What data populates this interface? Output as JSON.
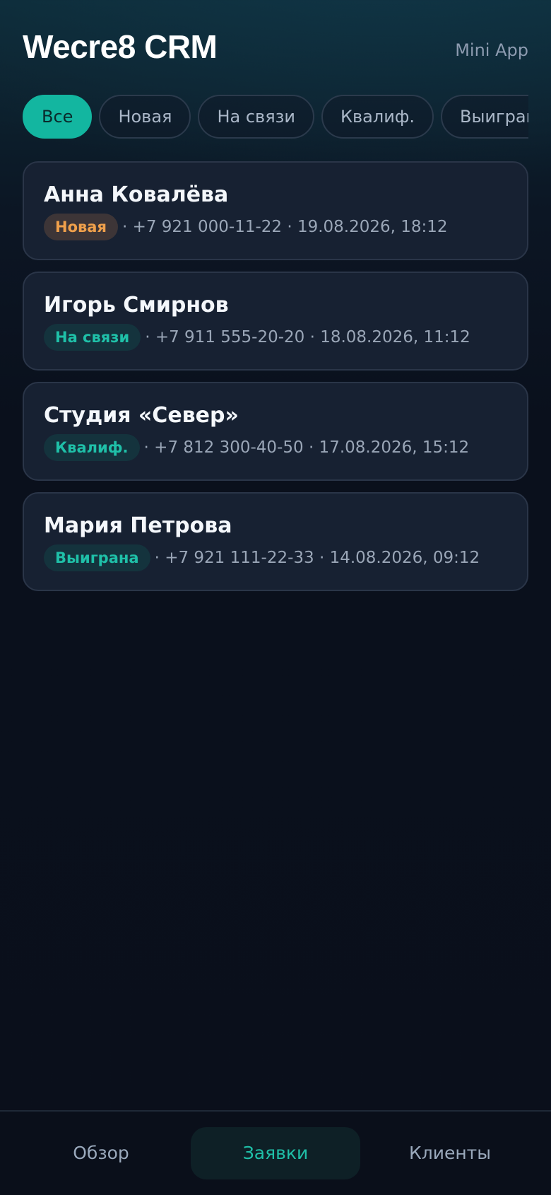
{
  "header": {
    "title": "Wecre8 CRM",
    "subtitle": "Mini App"
  },
  "filters": [
    {
      "label": "Все",
      "active": true
    },
    {
      "label": "Новая",
      "active": false
    },
    {
      "label": "На связи",
      "active": false
    },
    {
      "label": "Квалиф.",
      "active": false
    },
    {
      "label": "Выиграна",
      "active": false
    }
  ],
  "leads": [
    {
      "name": "Анна Ковалёва",
      "status": "Новая",
      "meta": "· +7 921 000-11-22 · 19.08.2026, 18:12"
    },
    {
      "name": "Игорь Смирнов",
      "status": "На связи",
      "meta": "· +7 911 555-20-20 · 18.08.2026, 11:12"
    },
    {
      "name": "Студия «Север»",
      "status": "Квалиф.",
      "meta": "· +7 812 300-40-50 · 17.08.2026, 15:12"
    },
    {
      "name": "Мария Петрова",
      "status": "Выиграна",
      "meta": "· +7 921 111-22-33 · 14.08.2026, 09:12"
    }
  ],
  "nav": {
    "overview": "Обзор",
    "leads": "Заявки",
    "clients": "Клиенты",
    "active": "leads"
  },
  "colors": {
    "accent": "#13b6a0",
    "status_new": "#f0a04b",
    "status_other": "#1fc0a8",
    "card_bg": "#172132",
    "page_bg": "#0a0f1b"
  }
}
